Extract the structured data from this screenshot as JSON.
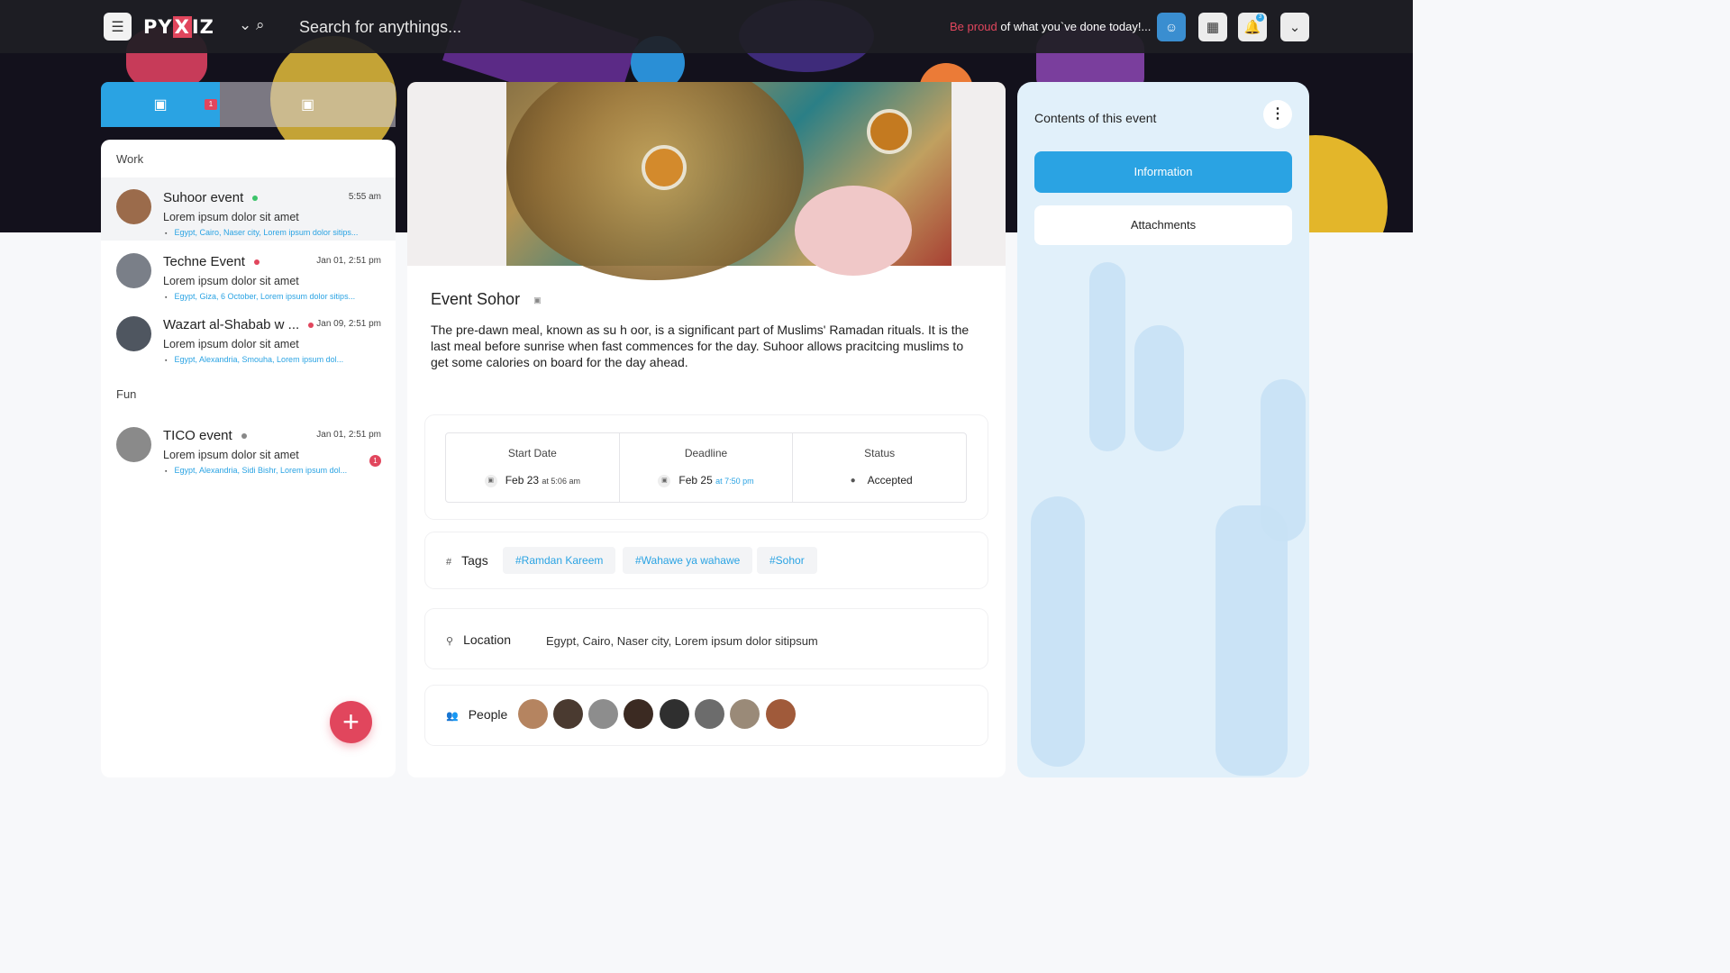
{
  "header": {
    "logo": {
      "pre": "PY",
      "x": "X",
      "post": "IZ"
    },
    "search_placeholder": "Search for anythings...",
    "motto_accent": "Be proud",
    "motto_rest": " of what you`ve done today!...",
    "notifications": "3"
  },
  "left": {
    "tab_badge": "1",
    "groups": {
      "work": "Work",
      "fun": "Fun"
    },
    "events": [
      {
        "title": "Suhoor event",
        "time": "5:55 am",
        "desc": "Lorem ipsum dolor sit amet",
        "location": "Egypt, Cairo, Naser city, Lorem ipsum dolor sitips...",
        "status_color": "#3cc46a"
      },
      {
        "title": "Techne Event",
        "time": "Jan 01, 2:51 pm",
        "desc": "Lorem ipsum dolor sit amet",
        "location": "Egypt, Giza, 6 October, Lorem ipsum dolor sitips...",
        "status_color": "#e1465d"
      },
      {
        "title": "Wazart al-Shabab w ...",
        "time": "Jan 09, 2:51 pm",
        "desc": "Lorem ipsum dolor sit amet",
        "location": "Egypt, Alexandria, Smouha, Lorem ipsum dol...",
        "status_color": "#e1465d"
      },
      {
        "title": "TICO event",
        "time": "Jan 01, 2:51 pm",
        "desc": "Lorem ipsum dolor sit amet",
        "location": "Egypt, Alexandria, Sidi Bishr, Lorem ipsum dol...",
        "status_color": "#888888",
        "count": "1"
      }
    ],
    "fab": "+"
  },
  "event": {
    "title": "Event Sohor",
    "description": "The pre-dawn meal, known as su h oor, is a significant part of Muslims' Ramadan rituals. It is the last meal before sunrise when fast commences for the day. Suhoor allows pracitcing muslims to get some calories on board for the day ahead.",
    "start": {
      "label": "Start Date",
      "date": "Feb 23",
      "time": "at 5:06 am"
    },
    "deadline": {
      "label": "Deadline",
      "date": "Feb 25",
      "time": "at 7:50 pm"
    },
    "status": {
      "label": "Status",
      "value": "Accepted"
    },
    "tags_label": "Tags",
    "tags": [
      "#Ramdan Kareem",
      "#Wahawe ya wahawe",
      "#Sohor"
    ],
    "location_label": "Location",
    "location": "Egypt, Cairo, Naser city, Lorem ipsum dolor sitipsum",
    "people_label": "People"
  },
  "right": {
    "title": "Contents of this event",
    "information": "Information",
    "attachments": "Attachments"
  },
  "colors": {
    "accent": "#2aa3e3",
    "brand_red": "#e1465d"
  }
}
